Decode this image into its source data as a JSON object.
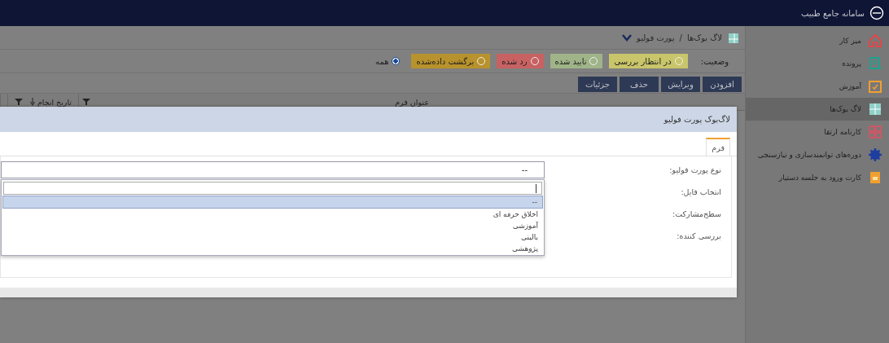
{
  "header": {
    "title": "سامانه جامع طبیب"
  },
  "sidebar": {
    "items": [
      {
        "label": "میز کار",
        "kind": "house",
        "selected": false
      },
      {
        "label": "پرونده",
        "kind": "document",
        "selected": false
      },
      {
        "label": "آموزش",
        "kind": "clipboard",
        "selected": false
      },
      {
        "label": "لاگ بوک‌ها",
        "kind": "book",
        "selected": true
      },
      {
        "label": "کارنامه ارتقا",
        "kind": "grid",
        "selected": false
      },
      {
        "label": "دوره‌های توانمندسازی و نیازسنجی",
        "kind": "gear",
        "selected": false
      },
      {
        "label": "کارت ورود به جلسه دستیار",
        "kind": "card",
        "selected": false
      }
    ]
  },
  "breadcrumb": {
    "items": [
      "لاگ بوک‌ها",
      "پورت فولیو"
    ],
    "separator": "/"
  },
  "status_filter": {
    "label": "وضعیت:",
    "options": [
      {
        "label": "در انتظار بررسی",
        "color": "#c9c56a",
        "selected": false
      },
      {
        "label": "تایید شده",
        "color": "#9fb488",
        "selected": false
      },
      {
        "label": "رد شده",
        "color": "#c86262",
        "selected": false
      },
      {
        "label": "برگشت داده‌شده",
        "color": "#b8922c",
        "selected": false
      },
      {
        "label": "همه",
        "selected": true
      }
    ]
  },
  "toolbar": {
    "buttons": [
      "افزودن",
      "ویرایش",
      "حذف",
      "جزئیات"
    ]
  },
  "table": {
    "columns": [
      {
        "title": "عنوان فرم",
        "sorted": false
      },
      {
        "title": "تاریخ انجام",
        "sorted": true
      }
    ]
  },
  "dialog": {
    "title": "لاگ‌بوک پورت فولیو",
    "tabs": [
      {
        "label": "فرم",
        "selected": true
      }
    ],
    "fields": [
      {
        "label": "نوع پورت فولیو:",
        "kind": "select",
        "value": "--",
        "expanded": true
      },
      {
        "label": "انتخاب فایل:",
        "kind": "blank"
      },
      {
        "label": "سطح‌مشارکت:",
        "kind": "blank"
      },
      {
        "label": "بررسی کننده:",
        "kind": "blank"
      }
    ],
    "dropdown_options": [
      {
        "label": "--",
        "selected": true
      },
      {
        "label": "اخلاق حرفه ای",
        "selected": false
      },
      {
        "label": "آموزشی",
        "selected": false
      },
      {
        "label": "بالینی",
        "selected": false
      },
      {
        "label": "پژوهشی",
        "selected": false
      }
    ]
  }
}
